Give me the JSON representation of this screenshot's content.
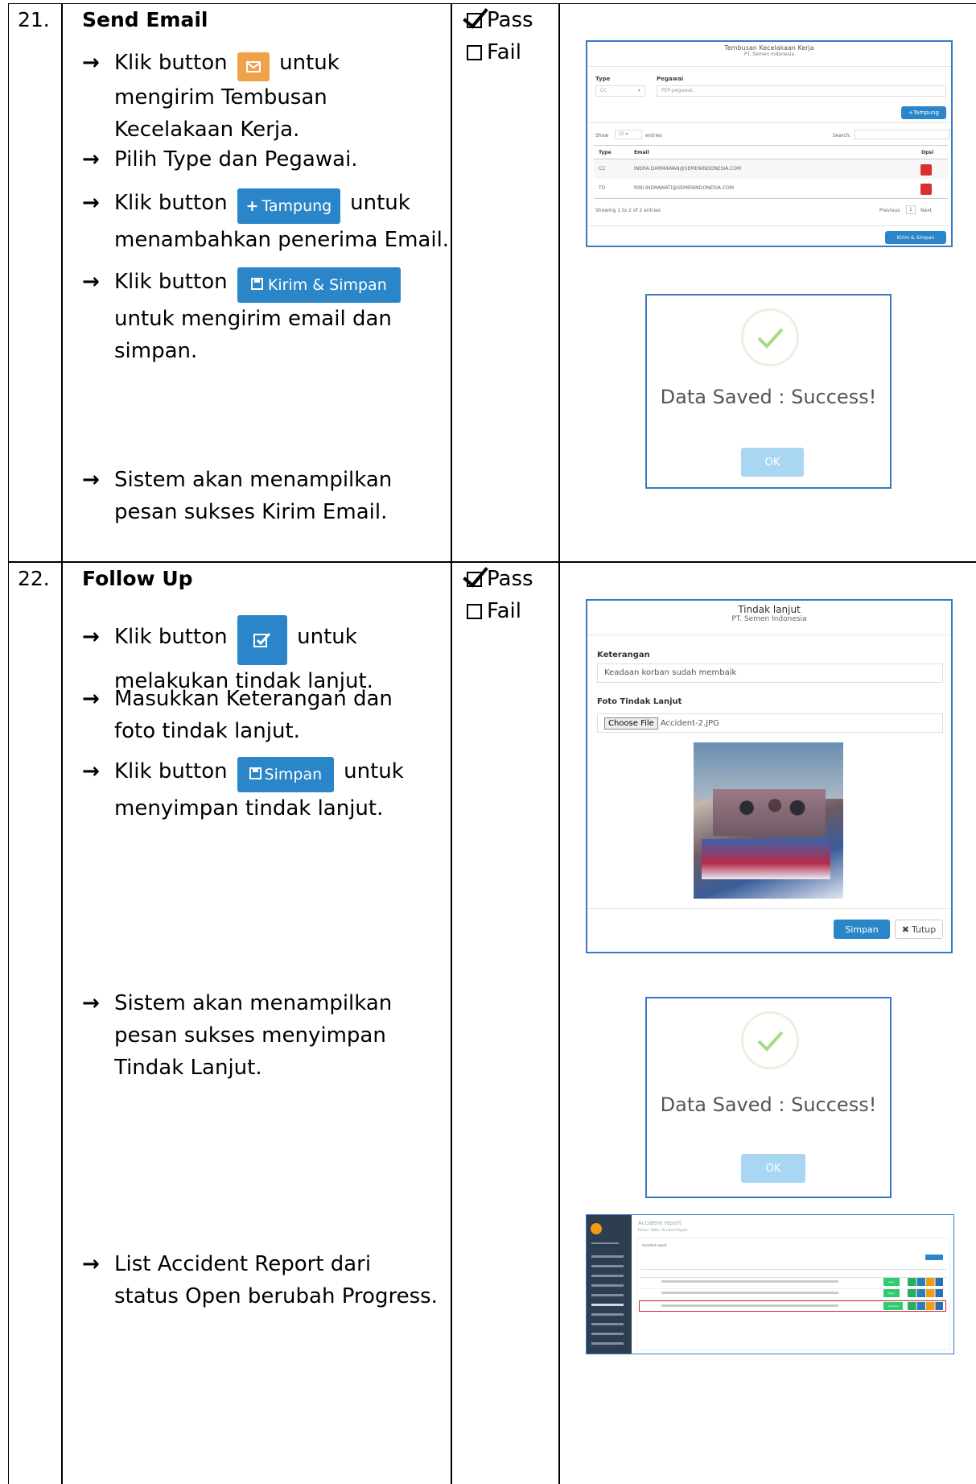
{
  "rows": [
    {
      "number": "21.",
      "title": "Send Email",
      "steps": {
        "s1_pre": "Klik button",
        "s1_post": "untuk",
        "s1_line2": "mengirim Tembusan",
        "s1_line3": "Kecelakaan Kerja.",
        "s2": "Pilih Type dan Pegawai.",
        "s3_pre": "Klik button",
        "s3_post": "untuk",
        "s3_line2": "menambahkan penerima Email.",
        "s4_pre": "Klik button",
        "s4_line2": "untuk mengirim email dan",
        "s4_line3": "simpan.",
        "s5_line1": "Sistem akan menampilkan",
        "s5_line2": "pesan sukses Kirim Email."
      },
      "buttons": {
        "tampung": "Tampung",
        "kirim": "Kirim & Simpan"
      },
      "pass_label": "Pass",
      "fail_label": "Fail",
      "pass_checked": true,
      "modal": {
        "title": "Tembusan Kecelakaan Kerja",
        "subtitle": "PT. Semen Indonesia",
        "type_label": "Type",
        "pegawai_label": "Pegawai",
        "type_value": "CC",
        "pegawai_placeholder": "PEP-pegawai...",
        "tampung": "Tampung",
        "show": "Show",
        "entries_value": "10",
        "entries": "entries",
        "search": "Search:",
        "col_type": "Type",
        "col_email": "Email",
        "col_opsi": "Opsi",
        "row1_type": "CC",
        "row1_email": "INDRA.DARMAWAN@SEMENINDONESIA.COM",
        "row2_type": "TO",
        "row2_email": "RINI.INDRAWATI@SEMENINDONESIA.COM",
        "showing": "Showing 1 to 2 of 2 entries",
        "previous": "Previous",
        "page": "1",
        "next": "Next",
        "kirim": "Kirim & Simpan"
      },
      "success": {
        "text": "Data Saved : Success!",
        "ok": "OK"
      }
    },
    {
      "number": "22.",
      "title": "Follow Up",
      "steps": {
        "s1_pre": "Klik button",
        "s1_post": "untuk",
        "s1_line2": "melakukan tindak lanjut.",
        "s2_line1": "Masukkan Keterangan dan",
        "s2_line2": "foto tindak lanjut.",
        "s3_pre": "Klik button",
        "s3_post": "untuk",
        "s3_line2": "menyimpan tindak lanjut.",
        "s4_line1": "Sistem akan menampilkan",
        "s4_line2": "pesan sukses menyimpan",
        "s4_line3": "Tindak Lanjut.",
        "s5_line1": "List Accident Report dari",
        "s5_line2": "status Open berubah Progress."
      },
      "buttons": {
        "simpan": "Simpan"
      },
      "pass_label": "Pass",
      "fail_label": "Fail",
      "pass_checked": true,
      "modal": {
        "title": "Tindak lanjut",
        "subtitle": "PT. Semen Indonesia",
        "keterangan_label": "Keterangan",
        "keterangan_value": "Keadaan korban sudah membaik",
        "foto_label": "Foto Tindak Lanjut",
        "choose_file": "Choose File",
        "file_name": "Accident-2.JPG",
        "simpan": "Simpan",
        "tutup": "Tutup"
      },
      "success": {
        "text": "Data Saved : Success!",
        "ok": "OK"
      },
      "list": {
        "title": "Accident report",
        "breadcrumb": "Home / SHEs / Accident Report",
        "panel": "Accident report",
        "status_open": "Open",
        "status_progress": "Progress"
      }
    }
  ],
  "colors": {
    "accent": "#2a86c8",
    "orange": "#f0a24a",
    "danger": "#d63031",
    "success": "#2ecc71",
    "frame": "#3b78c4"
  }
}
